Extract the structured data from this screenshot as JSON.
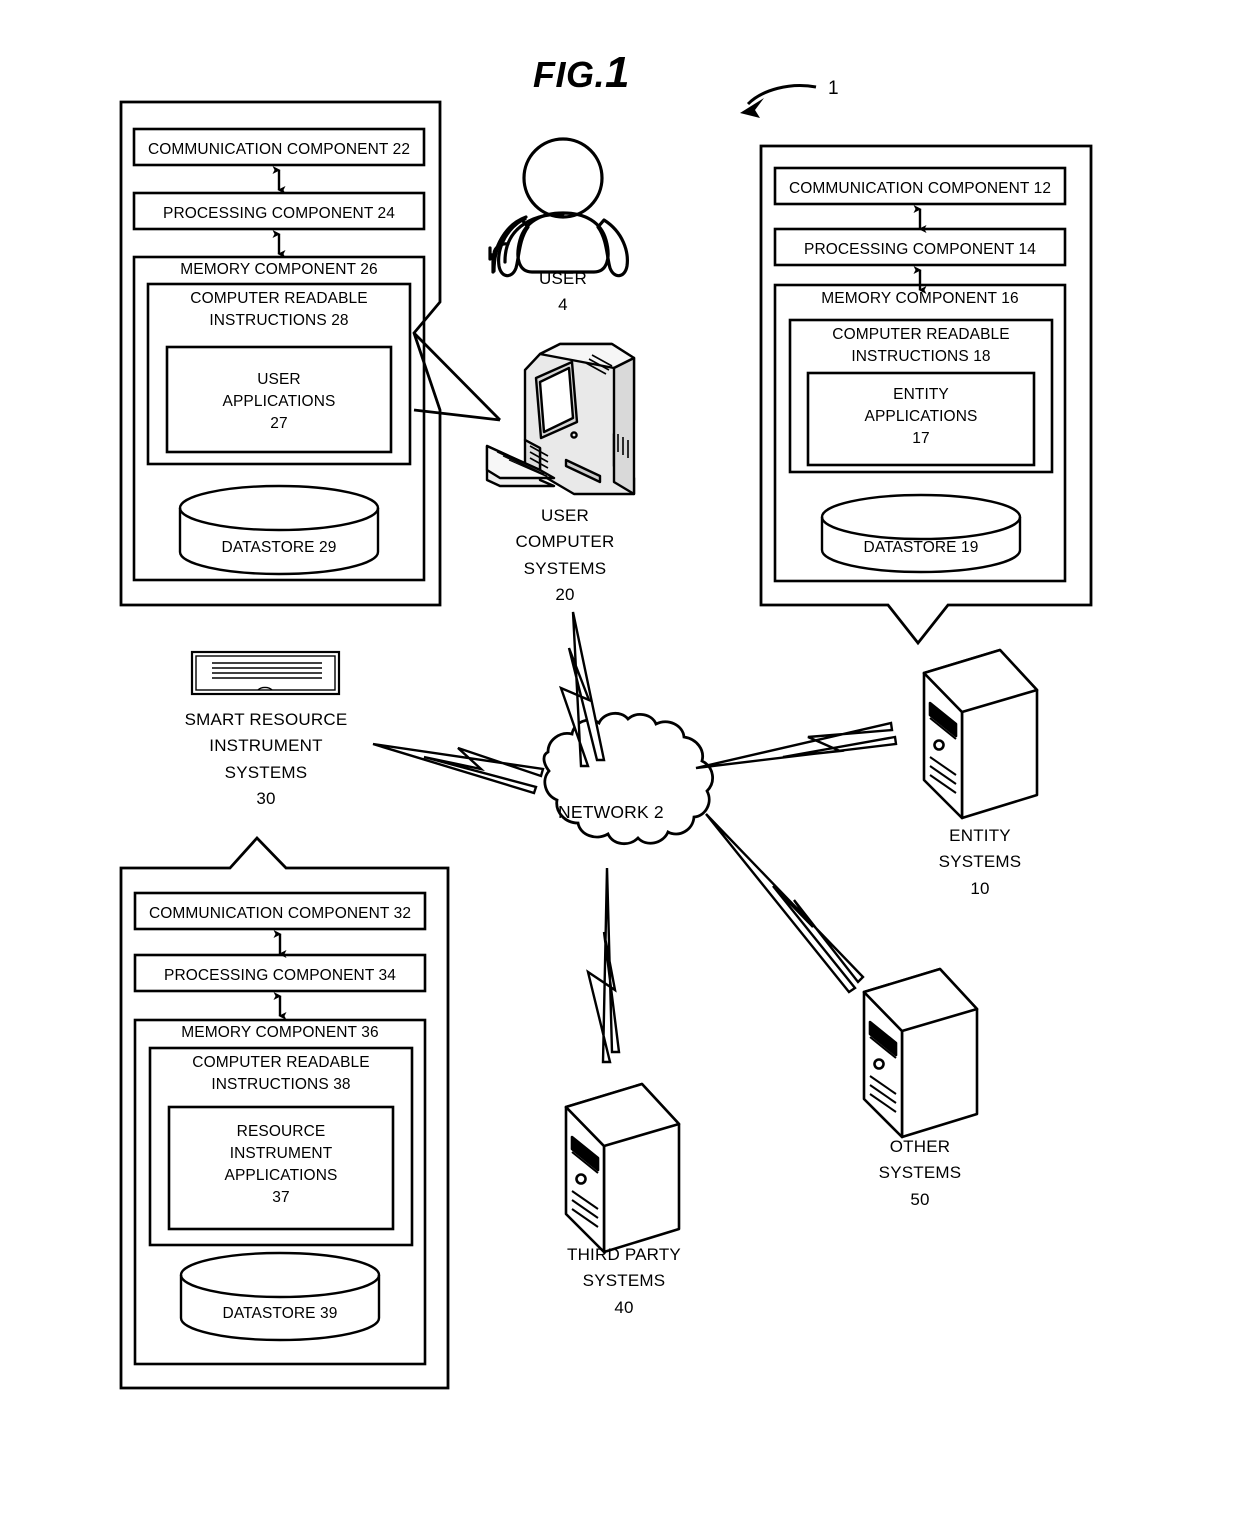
{
  "figure": {
    "title_prefix": "FIG.",
    "title_number": "1",
    "reference_numeral": "1"
  },
  "user_systems_panel": {
    "name": "user-computer-systems-detail",
    "communication_component": "COMMUNICATION COMPONENT 22",
    "processing_component": "PROCESSING COMPONENT 24",
    "memory_component": "MEMORY COMPONENT 26",
    "computer_readable_instructions": "COMPUTER READABLE\nINSTRUCTIONS 28",
    "cri_line1": "COMPUTER READABLE",
    "cri_line2": "INSTRUCTIONS 28",
    "applications_line1": "USER",
    "applications_line2": "APPLICATIONS",
    "applications_line3": "27",
    "datastore": "DATASTORE 29"
  },
  "entity_systems_panel": {
    "name": "entity-systems-detail",
    "communication_component": "COMMUNICATION COMPONENT 12",
    "processing_component": "PROCESSING COMPONENT  14",
    "memory_component": "MEMORY COMPONENT  16",
    "cri_line1": "COMPUTER READABLE",
    "cri_line2": "INSTRUCTIONS 18",
    "applications_line1": "ENTITY",
    "applications_line2": "APPLICATIONS",
    "applications_line3": "17",
    "datastore": "DATASTORE 19"
  },
  "resource_instrument_panel": {
    "name": "smart-resource-instrument-detail",
    "communication_component": "COMMUNICATION COMPONENT 32",
    "processing_component": "PROCESSING COMPONENT 34",
    "memory_component": "MEMORY COMPONENT 36",
    "cri_line1": "COMPUTER READABLE",
    "cri_line2": "INSTRUCTIONS 38",
    "applications_line1": "RESOURCE",
    "applications_line2": "INSTRUMENT",
    "applications_line3": "APPLICATIONS",
    "applications_line4": "37",
    "datastore": "DATASTORE 39"
  },
  "nodes": {
    "user": {
      "icon": "user-person-icon",
      "line1": "USER",
      "line2": "4"
    },
    "user_computer": {
      "icon": "desktop-computer-icon",
      "line1": "USER",
      "line2": "COMPUTER",
      "line3": "SYSTEMS",
      "line4": "20"
    },
    "smart_resource_instrument": {
      "icon": "card-document-icon",
      "line1": "SMART RESOURCE",
      "line2": "INSTRUMENT",
      "line3": "SYSTEMS",
      "line4": "30"
    },
    "entity_systems": {
      "icon": "server-tower-icon",
      "line1": "ENTITY",
      "line2": "SYSTEMS",
      "line3": "10"
    },
    "other_systems": {
      "icon": "server-tower-icon",
      "line1": "OTHER",
      "line2": "SYSTEMS",
      "line3": "50"
    },
    "third_party_systems": {
      "icon": "server-tower-icon",
      "line1": "THIRD PARTY",
      "line2": "SYSTEMS",
      "line3": "40"
    },
    "network": {
      "icon": "cloud-icon",
      "label": "NETWORK 2"
    }
  },
  "colors": {
    "stroke": "#000000",
    "background": "#ffffff",
    "fill_none": "none"
  }
}
